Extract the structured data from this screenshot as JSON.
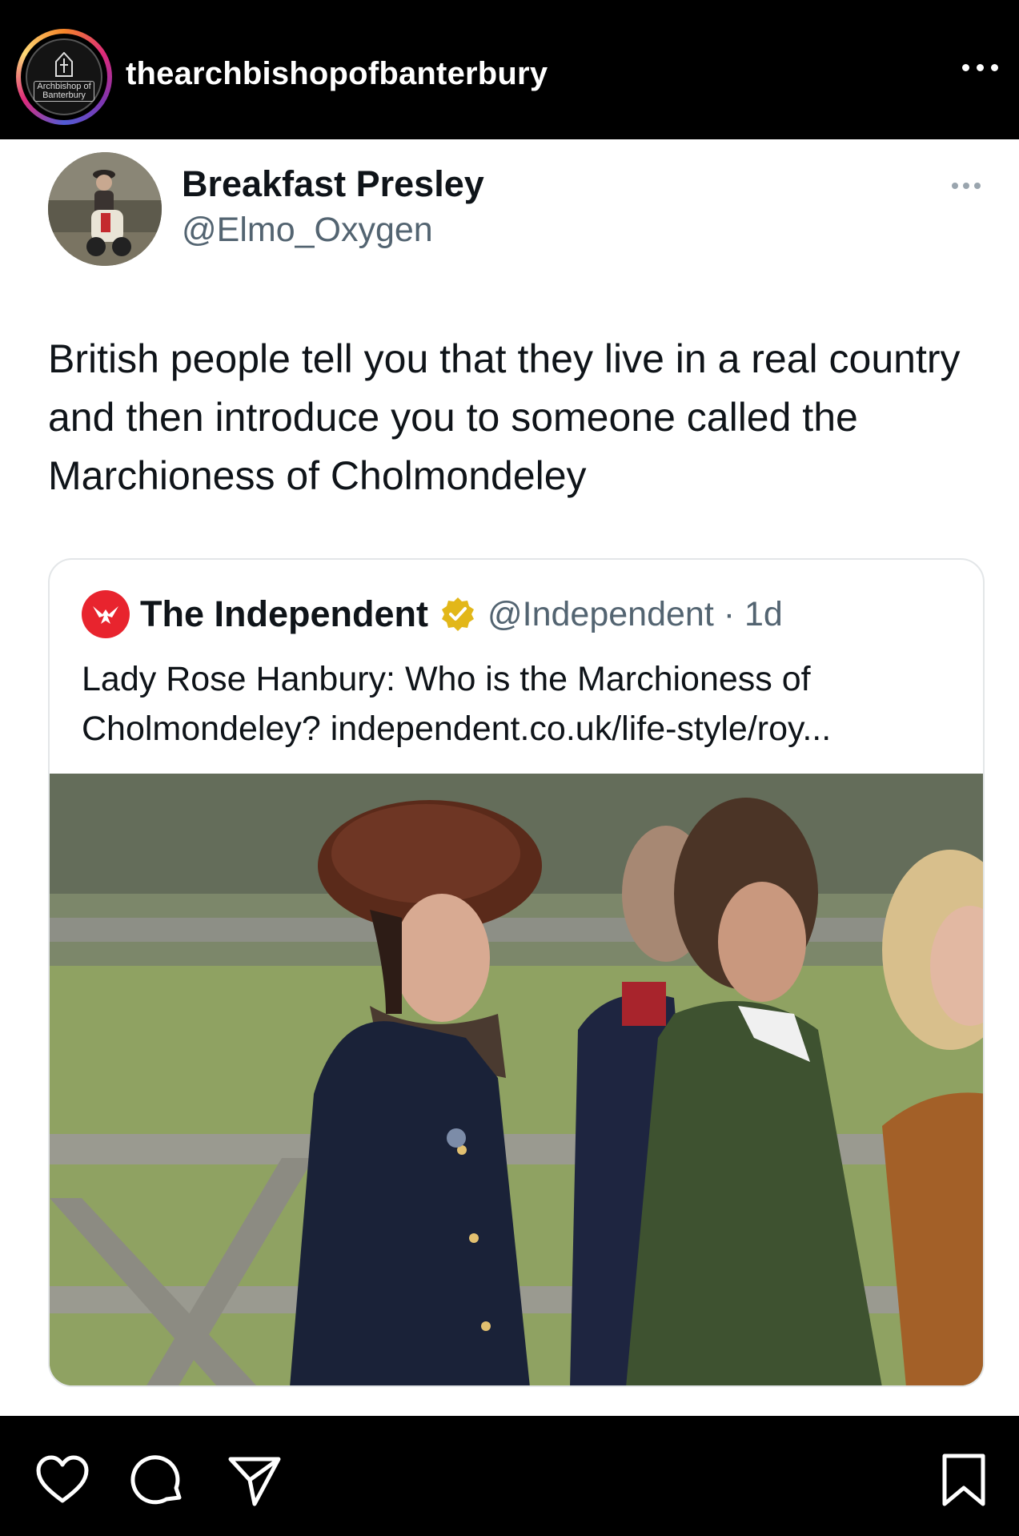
{
  "instagram": {
    "username": "thearchbishopofbanterbury",
    "avatar_logo_text_line1": "Archbishop of",
    "avatar_logo_text_line2": "Banterbury",
    "more_icon": "more-horizontal-icon",
    "actions": {
      "like_icon": "heart-icon",
      "comment_icon": "comment-icon",
      "share_icon": "send-icon",
      "save_icon": "bookmark-icon"
    }
  },
  "tweet": {
    "display_name": "Breakfast Presley",
    "handle": "@Elmo_Oxygen",
    "text": "British people tell you that they live in a real country and then introduce you to someone called the Marchioness of Cholmondeley"
  },
  "quoted_tweet": {
    "display_name": "The Independent",
    "handle_time": "@Independent · 1d",
    "text": "Lady Rose Hanbury: Who is the Marchioness of Cholmondeley? independent.co.uk/life-style/roy..."
  },
  "colors": {
    "independent_red": "#e8242e",
    "verified_gold": "#e2b719",
    "handle_gray": "#536471"
  }
}
